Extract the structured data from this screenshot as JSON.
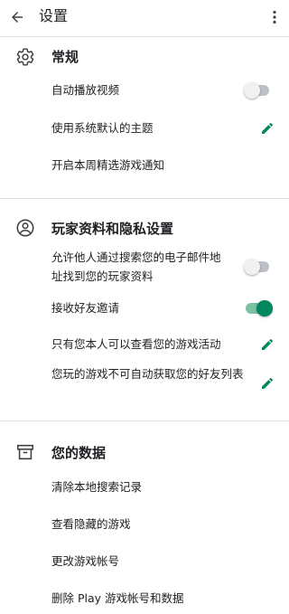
{
  "header": {
    "title": "设置",
    "back_icon": "arrow-back-icon",
    "more_icon": "more-vert-icon"
  },
  "colors": {
    "accent": "#01875f",
    "text": "#202124",
    "divider": "#e0e0e0"
  },
  "general": {
    "icon": "gear-icon",
    "title": "常规",
    "autoplay_label": "自动播放视频",
    "autoplay_on": false,
    "theme_label": "使用系统默认的主题",
    "weekly_label": "开启本周精选游戏通知"
  },
  "profile": {
    "icon": "account-circle-icon",
    "title": "玩家资料和隐私设置",
    "find_by_email_label": "允许他人通过搜索您的电子邮件地址找到您的玩家资料",
    "find_by_email_on": false,
    "friend_invites_label": "接收好友邀请",
    "friend_invites_on": true,
    "activity_label": "只有您本人可以查看您的游戏活动",
    "friends_list_label": "您玩的游戏不可自动获取您的好友列表"
  },
  "data": {
    "icon": "archive-icon",
    "title": "您的数据",
    "clear_search_label": "清除本地搜索记录",
    "hidden_games_label": "查看隐藏的游戏",
    "change_account_label": "更改游戏帐号",
    "delete_label": "删除 Play 游戏帐号和数据"
  }
}
